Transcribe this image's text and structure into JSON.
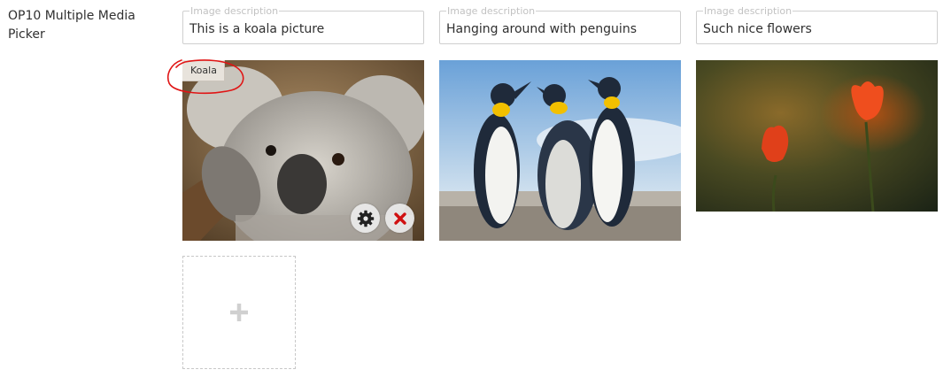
{
  "field": {
    "label": "OP10 Multiple Media Picker"
  },
  "items": [
    {
      "placeholder": "Image description",
      "value": "This is a koala picture",
      "name": "Koala",
      "image_icon": "koala-image"
    },
    {
      "placeholder": "Image description",
      "value": "Hanging around with penguins",
      "image_icon": "penguins-image"
    },
    {
      "placeholder": "Image description",
      "value": "Such nice flowers",
      "image_icon": "tulips-image"
    }
  ],
  "actions": {
    "settings_icon": "gear-icon",
    "remove_icon": "close-icon"
  },
  "add": {
    "icon": "plus-icon"
  },
  "colors": {
    "annotation": "#e01515",
    "remove": "#d01010",
    "plus": "#d0d0d0"
  }
}
